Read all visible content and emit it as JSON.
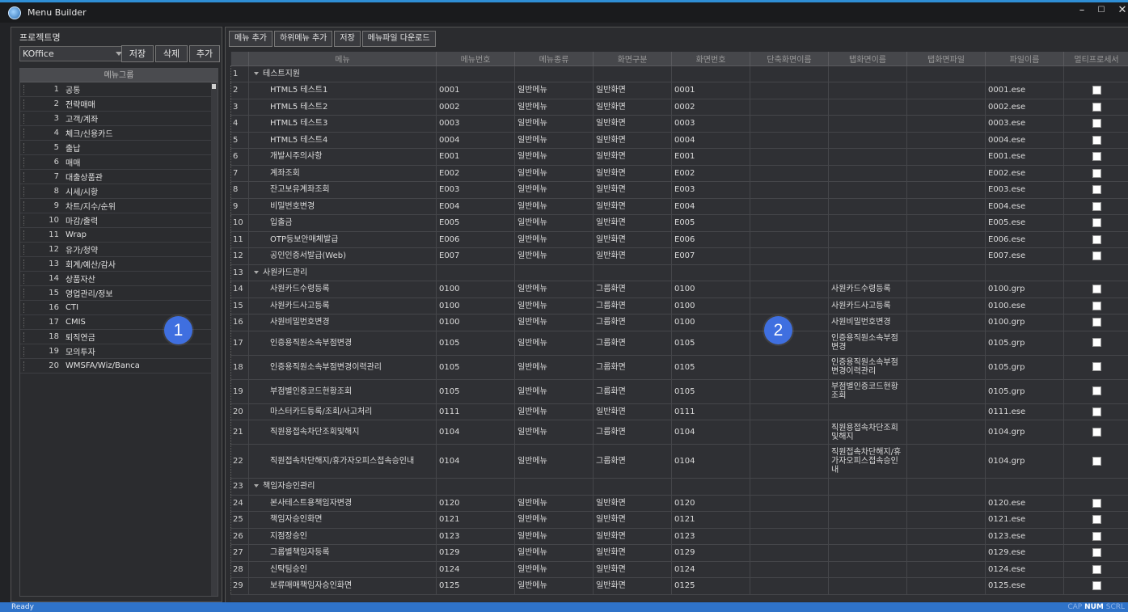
{
  "window": {
    "title": "Menu Builder",
    "minimize": "–",
    "maximize": "☐",
    "close": "✕"
  },
  "left": {
    "project_label": "프로젝트명",
    "project_value": "KOffice",
    "buttons": {
      "save": "저장",
      "delete": "삭제",
      "add": "추가"
    },
    "group_header": "메뉴그룹",
    "groups": [
      {
        "num": "1",
        "name": "공통"
      },
      {
        "num": "2",
        "name": "전략매매"
      },
      {
        "num": "3",
        "name": "고객/계좌"
      },
      {
        "num": "4",
        "name": "체크/신용카드"
      },
      {
        "num": "5",
        "name": "출납"
      },
      {
        "num": "6",
        "name": "매매"
      },
      {
        "num": "7",
        "name": "대출상품관"
      },
      {
        "num": "8",
        "name": "시세/시황"
      },
      {
        "num": "9",
        "name": "차트/지수/순위"
      },
      {
        "num": "10",
        "name": "마감/출력"
      },
      {
        "num": "11",
        "name": "Wrap"
      },
      {
        "num": "12",
        "name": "유가/청약"
      },
      {
        "num": "13",
        "name": "회계/예산/감사"
      },
      {
        "num": "14",
        "name": "상품자산"
      },
      {
        "num": "15",
        "name": "영업관리/정보"
      },
      {
        "num": "16",
        "name": "CTI"
      },
      {
        "num": "17",
        "name": "CMIS"
      },
      {
        "num": "18",
        "name": "퇴직연금"
      },
      {
        "num": "19",
        "name": "모의투자"
      },
      {
        "num": "20",
        "name": "WMSFA/Wiz/Banca"
      }
    ],
    "badge": "1"
  },
  "main": {
    "toolbar": {
      "add_menu": "메뉴 추가",
      "add_submenu": "하위메뉴 추가",
      "save": "저장",
      "download": "메뉴파일 다운로드"
    },
    "columns": [
      "메뉴",
      "메뉴번호",
      "메뉴종류",
      "화면구분",
      "화면번호",
      "단축화면이름",
      "탭화면이름",
      "탭화면파일",
      "파일이름",
      "멀티프로세서"
    ],
    "badge": "2",
    "rows": [
      {
        "n": "1",
        "type": "group",
        "menu": "테스트지원",
        "no": "",
        "kind": "",
        "screen": "",
        "sno": "",
        "short": "",
        "tab": "",
        "tabfile": "",
        "file": "",
        "chk": false
      },
      {
        "n": "2",
        "type": "item",
        "menu": "HTML5 테스트1",
        "no": "0001",
        "kind": "일반메뉴",
        "screen": "일반화면",
        "sno": "0001",
        "short": "",
        "tab": "",
        "tabfile": "",
        "file": "0001.ese",
        "chk": true
      },
      {
        "n": "3",
        "type": "item",
        "menu": "HTML5 테스트2",
        "no": "0002",
        "kind": "일반메뉴",
        "screen": "일반화면",
        "sno": "0002",
        "short": "",
        "tab": "",
        "tabfile": "",
        "file": "0002.ese",
        "chk": true
      },
      {
        "n": "4",
        "type": "item",
        "menu": "HTML5 테스트3",
        "no": "0003",
        "kind": "일반메뉴",
        "screen": "일반화면",
        "sno": "0003",
        "short": "",
        "tab": "",
        "tabfile": "",
        "file": "0003.ese",
        "chk": true
      },
      {
        "n": "5",
        "type": "item",
        "menu": "HTML5 테스트4",
        "no": "0004",
        "kind": "일반메뉴",
        "screen": "일반화면",
        "sno": "0004",
        "short": "",
        "tab": "",
        "tabfile": "",
        "file": "0004.ese",
        "chk": true
      },
      {
        "n": "6",
        "type": "item",
        "menu": "개발시주의사항",
        "no": "E001",
        "kind": "일반메뉴",
        "screen": "일반화면",
        "sno": "E001",
        "short": "",
        "tab": "",
        "tabfile": "",
        "file": "E001.ese",
        "chk": true
      },
      {
        "n": "7",
        "type": "item",
        "menu": "계좌조회",
        "no": "E002",
        "kind": "일반메뉴",
        "screen": "일반화면",
        "sno": "E002",
        "short": "",
        "tab": "",
        "tabfile": "",
        "file": "E002.ese",
        "chk": true
      },
      {
        "n": "8",
        "type": "item",
        "menu": "잔고보유계좌조회",
        "no": "E003",
        "kind": "일반메뉴",
        "screen": "일반화면",
        "sno": "E003",
        "short": "",
        "tab": "",
        "tabfile": "",
        "file": "E003.ese",
        "chk": true
      },
      {
        "n": "9",
        "type": "item",
        "menu": "비밀번호변경",
        "no": "E004",
        "kind": "일반메뉴",
        "screen": "일반화면",
        "sno": "E004",
        "short": "",
        "tab": "",
        "tabfile": "",
        "file": "E004.ese",
        "chk": true
      },
      {
        "n": "10",
        "type": "item",
        "menu": "입출금",
        "no": "E005",
        "kind": "일반메뉴",
        "screen": "일반화면",
        "sno": "E005",
        "short": "",
        "tab": "",
        "tabfile": "",
        "file": "E005.ese",
        "chk": true
      },
      {
        "n": "11",
        "type": "item",
        "menu": "OTP등보안매체발급",
        "no": "E006",
        "kind": "일반메뉴",
        "screen": "일반화면",
        "sno": "E006",
        "short": "",
        "tab": "",
        "tabfile": "",
        "file": "E006.ese",
        "chk": true
      },
      {
        "n": "12",
        "type": "item",
        "menu": "공인인증서발급(Web)",
        "no": "E007",
        "kind": "일반메뉴",
        "screen": "일반화면",
        "sno": "E007",
        "short": "",
        "tab": "",
        "tabfile": "",
        "file": "E007.ese",
        "chk": true
      },
      {
        "n": "13",
        "type": "group",
        "menu": "사원카드관리",
        "no": "",
        "kind": "",
        "screen": "",
        "sno": "",
        "short": "",
        "tab": "",
        "tabfile": "",
        "file": "",
        "chk": false
      },
      {
        "n": "14",
        "type": "item",
        "menu": "사원카드수령등록",
        "no": "0100",
        "kind": "일반메뉴",
        "screen": "그룹화면",
        "sno": "0100",
        "short": "",
        "tab": "사원카드수령등록",
        "tabfile": "",
        "file": "0100.grp",
        "chk": true
      },
      {
        "n": "15",
        "type": "item",
        "menu": "사원카드사고등록",
        "no": "0100",
        "kind": "일반메뉴",
        "screen": "그룹화면",
        "sno": "0100",
        "short": "",
        "tab": "사원카드사고등록",
        "tabfile": "",
        "file": "0100.ese",
        "chk": true
      },
      {
        "n": "16",
        "type": "item",
        "menu": "사원비밀번호변경",
        "no": "0100",
        "kind": "일반메뉴",
        "screen": "그룹화면",
        "sno": "0100",
        "short": "",
        "tab": "사원비밀번호변경",
        "tabfile": "",
        "file": "0100.grp",
        "chk": true
      },
      {
        "n": "17",
        "type": "item",
        "menu": "인증용직원소속부점변경",
        "no": "0105",
        "kind": "일반메뉴",
        "screen": "그룹화면",
        "sno": "0105",
        "short": "",
        "tab": "인증용직원소속부점변경",
        "tabfile": "",
        "file": "0105.grp",
        "chk": true,
        "tall": true
      },
      {
        "n": "18",
        "type": "item",
        "menu": "인증용직원소속부점변경이력관리",
        "no": "0105",
        "kind": "일반메뉴",
        "screen": "그룹화면",
        "sno": "0105",
        "short": "",
        "tab": "인증용직원소속부점변경이력관리",
        "tabfile": "",
        "file": "0105.grp",
        "chk": true,
        "tall": true
      },
      {
        "n": "19",
        "type": "item",
        "menu": "부점별인증코드현황조회",
        "no": "0105",
        "kind": "일반메뉴",
        "screen": "그룹화면",
        "sno": "0105",
        "short": "",
        "tab": "부점별인증코드현황조회",
        "tabfile": "",
        "file": "0105.grp",
        "chk": true,
        "tall": true
      },
      {
        "n": "20",
        "type": "item",
        "menu": "마스터카드등록/조회/사고처리",
        "no": "0111",
        "kind": "일반메뉴",
        "screen": "일반화면",
        "sno": "0111",
        "short": "",
        "tab": "",
        "tabfile": "",
        "file": "0111.ese",
        "chk": true
      },
      {
        "n": "21",
        "type": "item",
        "menu": "직원용접속차단조회및해지",
        "no": "0104",
        "kind": "일반메뉴",
        "screen": "그룹화면",
        "sno": "0104",
        "short": "",
        "tab": "직원용접속차단조회및해지",
        "tabfile": "",
        "file": "0104.grp",
        "chk": true,
        "tall": true
      },
      {
        "n": "22",
        "type": "item",
        "menu": "직원접속차단해지/휴가자오피스접속승인내",
        "no": "0104",
        "kind": "일반메뉴",
        "screen": "그룹화면",
        "sno": "0104",
        "short": "",
        "tab": "직원접속차단해지/휴가자오피스접속승인내",
        "tabfile": "",
        "file": "0104.grp",
        "chk": true,
        "xtall": true
      },
      {
        "n": "23",
        "type": "group",
        "menu": "책임자승인관리",
        "no": "",
        "kind": "",
        "screen": "",
        "sno": "",
        "short": "",
        "tab": "",
        "tabfile": "",
        "file": "",
        "chk": false
      },
      {
        "n": "24",
        "type": "item",
        "menu": "본사테스트용책임자변경",
        "no": "0120",
        "kind": "일반메뉴",
        "screen": "일반화면",
        "sno": "0120",
        "short": "",
        "tab": "",
        "tabfile": "",
        "file": "0120.ese",
        "chk": true
      },
      {
        "n": "25",
        "type": "item",
        "menu": "책임자승인화면",
        "no": "0121",
        "kind": "일반메뉴",
        "screen": "일반화면",
        "sno": "0121",
        "short": "",
        "tab": "",
        "tabfile": "",
        "file": "0121.ese",
        "chk": true
      },
      {
        "n": "26",
        "type": "item",
        "menu": "지점장승인",
        "no": "0123",
        "kind": "일반메뉴",
        "screen": "일반화면",
        "sno": "0123",
        "short": "",
        "tab": "",
        "tabfile": "",
        "file": "0123.ese",
        "chk": true
      },
      {
        "n": "27",
        "type": "item",
        "menu": "그룹별책임자등록",
        "no": "0129",
        "kind": "일반메뉴",
        "screen": "일반화면",
        "sno": "0129",
        "short": "",
        "tab": "",
        "tabfile": "",
        "file": "0129.ese",
        "chk": true
      },
      {
        "n": "28",
        "type": "item",
        "menu": "신탁팀승인",
        "no": "0124",
        "kind": "일반메뉴",
        "screen": "일반화면",
        "sno": "0124",
        "short": "",
        "tab": "",
        "tabfile": "",
        "file": "0124.ese",
        "chk": true
      },
      {
        "n": "29",
        "type": "item",
        "menu": "보류매매책임자승인화면",
        "no": "0125",
        "kind": "일반메뉴",
        "screen": "일반화면",
        "sno": "0125",
        "short": "",
        "tab": "",
        "tabfile": "",
        "file": "0125.ese",
        "chk": true
      }
    ]
  },
  "status": {
    "left": "Ready",
    "cap": "CAP",
    "num": "NUM",
    "scrl": "SCRL"
  }
}
